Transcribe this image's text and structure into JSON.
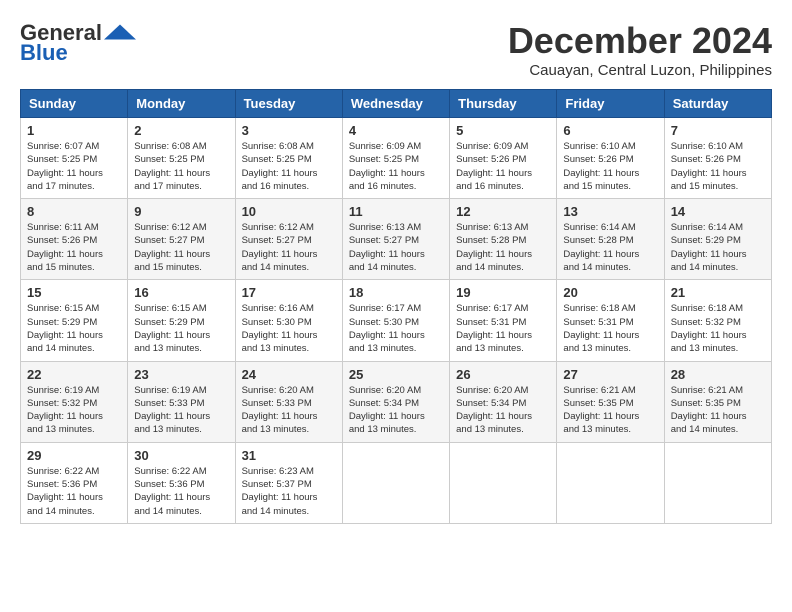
{
  "header": {
    "logo_general": "General",
    "logo_blue": "Blue",
    "title": "December 2024",
    "subtitle": "Cauayan, Central Luzon, Philippines"
  },
  "calendar": {
    "headers": [
      "Sunday",
      "Monday",
      "Tuesday",
      "Wednesday",
      "Thursday",
      "Friday",
      "Saturday"
    ],
    "weeks": [
      [
        {
          "day": "1",
          "sunrise": "6:07 AM",
          "sunset": "5:25 PM",
          "daylight": "11 hours and 17 minutes."
        },
        {
          "day": "2",
          "sunrise": "6:08 AM",
          "sunset": "5:25 PM",
          "daylight": "11 hours and 17 minutes."
        },
        {
          "day": "3",
          "sunrise": "6:08 AM",
          "sunset": "5:25 PM",
          "daylight": "11 hours and 16 minutes."
        },
        {
          "day": "4",
          "sunrise": "6:09 AM",
          "sunset": "5:25 PM",
          "daylight": "11 hours and 16 minutes."
        },
        {
          "day": "5",
          "sunrise": "6:09 AM",
          "sunset": "5:26 PM",
          "daylight": "11 hours and 16 minutes."
        },
        {
          "day": "6",
          "sunrise": "6:10 AM",
          "sunset": "5:26 PM",
          "daylight": "11 hours and 15 minutes."
        },
        {
          "day": "7",
          "sunrise": "6:10 AM",
          "sunset": "5:26 PM",
          "daylight": "11 hours and 15 minutes."
        }
      ],
      [
        {
          "day": "8",
          "sunrise": "6:11 AM",
          "sunset": "5:26 PM",
          "daylight": "11 hours and 15 minutes."
        },
        {
          "day": "9",
          "sunrise": "6:12 AM",
          "sunset": "5:27 PM",
          "daylight": "11 hours and 15 minutes."
        },
        {
          "day": "10",
          "sunrise": "6:12 AM",
          "sunset": "5:27 PM",
          "daylight": "11 hours and 14 minutes."
        },
        {
          "day": "11",
          "sunrise": "6:13 AM",
          "sunset": "5:27 PM",
          "daylight": "11 hours and 14 minutes."
        },
        {
          "day": "12",
          "sunrise": "6:13 AM",
          "sunset": "5:28 PM",
          "daylight": "11 hours and 14 minutes."
        },
        {
          "day": "13",
          "sunrise": "6:14 AM",
          "sunset": "5:28 PM",
          "daylight": "11 hours and 14 minutes."
        },
        {
          "day": "14",
          "sunrise": "6:14 AM",
          "sunset": "5:29 PM",
          "daylight": "11 hours and 14 minutes."
        }
      ],
      [
        {
          "day": "15",
          "sunrise": "6:15 AM",
          "sunset": "5:29 PM",
          "daylight": "11 hours and 14 minutes."
        },
        {
          "day": "16",
          "sunrise": "6:15 AM",
          "sunset": "5:29 PM",
          "daylight": "11 hours and 13 minutes."
        },
        {
          "day": "17",
          "sunrise": "6:16 AM",
          "sunset": "5:30 PM",
          "daylight": "11 hours and 13 minutes."
        },
        {
          "day": "18",
          "sunrise": "6:17 AM",
          "sunset": "5:30 PM",
          "daylight": "11 hours and 13 minutes."
        },
        {
          "day": "19",
          "sunrise": "6:17 AM",
          "sunset": "5:31 PM",
          "daylight": "11 hours and 13 minutes."
        },
        {
          "day": "20",
          "sunrise": "6:18 AM",
          "sunset": "5:31 PM",
          "daylight": "11 hours and 13 minutes."
        },
        {
          "day": "21",
          "sunrise": "6:18 AM",
          "sunset": "5:32 PM",
          "daylight": "11 hours and 13 minutes."
        }
      ],
      [
        {
          "day": "22",
          "sunrise": "6:19 AM",
          "sunset": "5:32 PM",
          "daylight": "11 hours and 13 minutes."
        },
        {
          "day": "23",
          "sunrise": "6:19 AM",
          "sunset": "5:33 PM",
          "daylight": "11 hours and 13 minutes."
        },
        {
          "day": "24",
          "sunrise": "6:20 AM",
          "sunset": "5:33 PM",
          "daylight": "11 hours and 13 minutes."
        },
        {
          "day": "25",
          "sunrise": "6:20 AM",
          "sunset": "5:34 PM",
          "daylight": "11 hours and 13 minutes."
        },
        {
          "day": "26",
          "sunrise": "6:20 AM",
          "sunset": "5:34 PM",
          "daylight": "11 hours and 13 minutes."
        },
        {
          "day": "27",
          "sunrise": "6:21 AM",
          "sunset": "5:35 PM",
          "daylight": "11 hours and 13 minutes."
        },
        {
          "day": "28",
          "sunrise": "6:21 AM",
          "sunset": "5:35 PM",
          "daylight": "11 hours and 14 minutes."
        }
      ],
      [
        {
          "day": "29",
          "sunrise": "6:22 AM",
          "sunset": "5:36 PM",
          "daylight": "11 hours and 14 minutes."
        },
        {
          "day": "30",
          "sunrise": "6:22 AM",
          "sunset": "5:36 PM",
          "daylight": "11 hours and 14 minutes."
        },
        {
          "day": "31",
          "sunrise": "6:23 AM",
          "sunset": "5:37 PM",
          "daylight": "11 hours and 14 minutes."
        },
        null,
        null,
        null,
        null
      ]
    ]
  }
}
